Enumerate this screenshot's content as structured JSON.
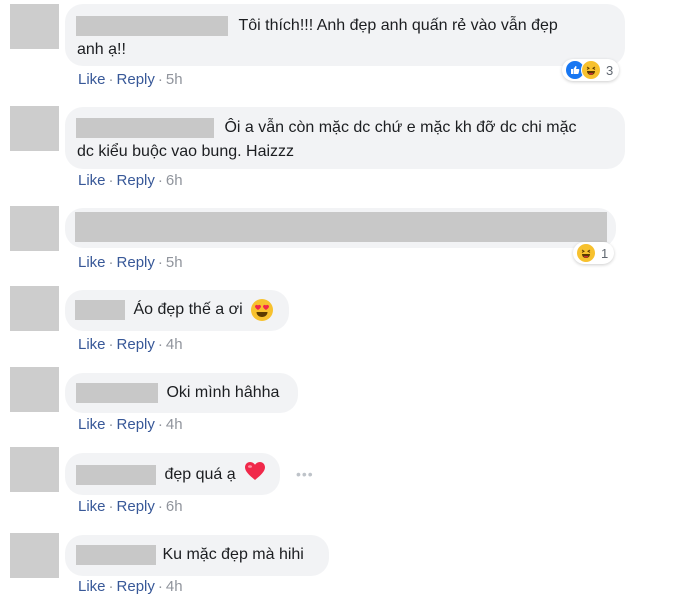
{
  "comments": [
    {
      "text": "Tôi thích!!! Anh đẹp anh quấn rẻ vào vẫn đẹp",
      "text2": "anh ạ!!",
      "like": "Like",
      "reply": "Reply",
      "time": "5h",
      "reaction_count": "3"
    },
    {
      "text": "Ôi a vẫn còn mặc dc chứ e mặc kh đỡ dc chi mặc",
      "text2": "dc kiểu buộc vao bung. Haizzz",
      "like": "Like",
      "reply": "Reply",
      "time": "6h"
    },
    {
      "text": "",
      "like": "Like",
      "reply": "Reply",
      "time": "5h",
      "reaction_count": "1"
    },
    {
      "text": "Áo đẹp thế a ơi",
      "like": "Like",
      "reply": "Reply",
      "time": "4h"
    },
    {
      "text": "Oki mình hâhha",
      "like": "Like",
      "reply": "Reply",
      "time": "4h"
    },
    {
      "text": "đẹp quá ạ",
      "like": "Like",
      "reply": "Reply",
      "time": "6h",
      "more": "•••"
    },
    {
      "text": "Ku mặc đẹp mà hihi",
      "like": "Like",
      "reply": "Reply",
      "time": "4h"
    }
  ],
  "separator": "·",
  "colors": {
    "link": "#385898",
    "bubble": "#f2f3f5",
    "muted": "#90949c",
    "like_blue": "#1877f2",
    "emoji_yellow": "#f7c12e",
    "heart_red": "#f0284a"
  },
  "icons": [
    "like-reaction-icon",
    "haha-reaction-icon",
    "heart-eyes-emoji-icon",
    "heart-emoji-icon",
    "more-options-icon"
  ]
}
